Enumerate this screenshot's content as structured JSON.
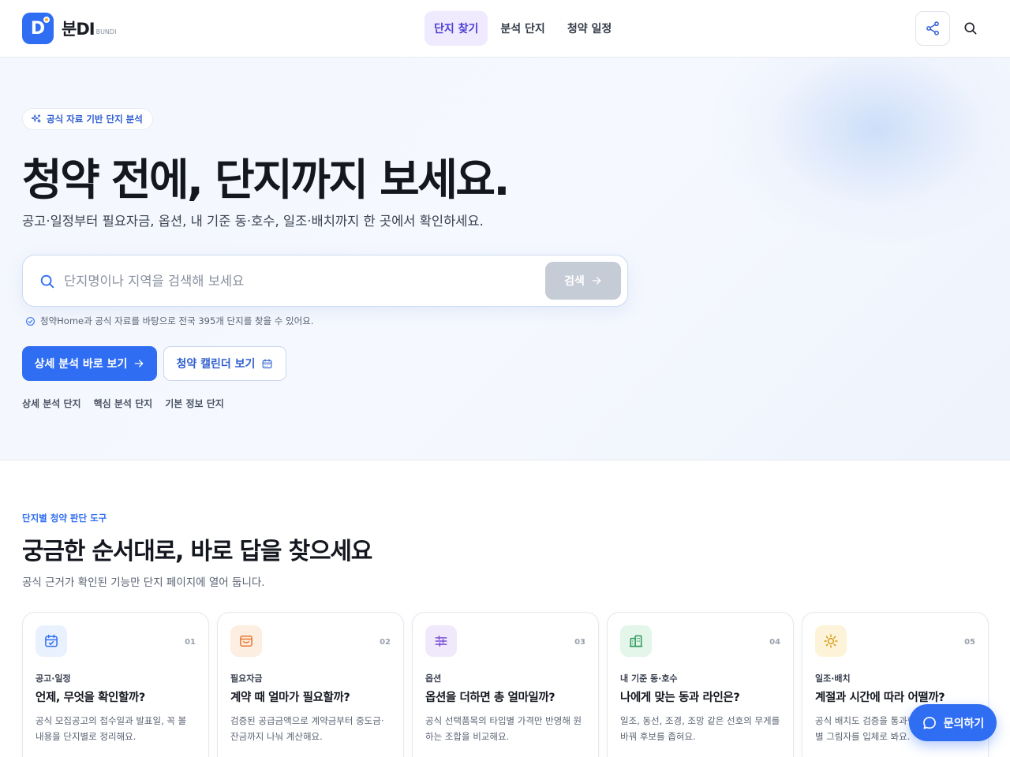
{
  "logo": {
    "mark": "D",
    "name": "분DI",
    "sub": "BUNDI"
  },
  "nav": [
    {
      "label": "단지 찾기",
      "active": true
    },
    {
      "label": "분석 단지",
      "active": false
    },
    {
      "label": "청약 일정",
      "active": false
    }
  ],
  "hero": {
    "badge": "공식 자료 기반 단지 분석",
    "title": "청약 전에, 단지까지 보세요.",
    "description": "공고·일정부터 필요자금, 옵션, 내 기준 동·호수, 일조·배치까지 한 곳에서 확인하세요.",
    "search": {
      "placeholder": "단지명이나 지역을 검색해 보세요",
      "value": "",
      "button": "검색"
    },
    "hint": "청약Home과 공식 자료를 바탕으로 전국 395개 단지를 찾을 수 있어요.",
    "primary_button": "상세 분석 바로 보기",
    "secondary_button": "청약 캘린더 보기",
    "links": [
      "상세 분석 단지",
      "핵심 분석 단지",
      "기본 정보 단지"
    ]
  },
  "section": {
    "eyebrow": "단지별 청약 판단 도구",
    "title": "궁금한 순서대로, 바로 답을 찾으세요",
    "description": "공식 근거가 확인된 기능만 단지 페이지에 열어 둡니다."
  },
  "cards": [
    {
      "num": "01",
      "icon": "calendar-icon",
      "color": "#2f6df3",
      "bg": "#eaf1fe",
      "category": "공고·일정",
      "title": "언제, 무엇을 확인할까?",
      "desc": "공식 모집공고의 접수일과 발표일, 꼭 볼 내용을 단지별로 정리해요."
    },
    {
      "num": "02",
      "icon": "wallet-icon",
      "color": "#e8762c",
      "bg": "#fdeee2",
      "category": "필요자금",
      "title": "계약 때 얼마가 필요할까?",
      "desc": "검증된 공급금액으로 계약금부터 중도금·잔금까지 나눠 계산해요."
    },
    {
      "num": "03",
      "icon": "sliders-icon",
      "color": "#7a4fd6",
      "bg": "#efe9fb",
      "category": "옵션",
      "title": "옵션을 더하면 총 얼마일까?",
      "desc": "공식 선택품목의 타입별 가격만 반영해 원하는 조합을 비교해요."
    },
    {
      "num": "04",
      "icon": "building-icon",
      "color": "#2f9a5a",
      "bg": "#e4f5ea",
      "category": "내 기준 동·호수",
      "title": "나에게 맞는 동과 라인은?",
      "desc": "일조, 동선, 조경, 조망 같은 선호의 무게를 바꿔 후보를 좁혀요."
    },
    {
      "num": "05",
      "icon": "sun-icon",
      "color": "#d99a16",
      "bg": "#fdf3d8",
      "category": "일조·배치",
      "title": "계절과 시간에 따라 어떨까?",
      "desc": "공식 배치도 검증을 통과한 단지의 동·라인별 그림자를 입체로 봐요."
    }
  ],
  "chat": {
    "label": "문의하기"
  }
}
